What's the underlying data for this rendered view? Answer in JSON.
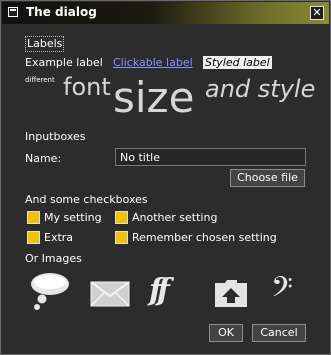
{
  "window": {
    "title": "The dialog",
    "close_glyph": "✕"
  },
  "labels_section": {
    "heading": "Labels",
    "example_label": "Example label",
    "clickable_label": "Clickable label",
    "styled_label": "Styled label",
    "font_demo": {
      "different": "different",
      "font": "font",
      "size": "size",
      "and_style": "and style"
    }
  },
  "inputboxes_section": {
    "heading": "Inputboxes",
    "name_label": "Name:",
    "name_value": "No title",
    "choose_file_label": "Choose file"
  },
  "checkboxes_section": {
    "heading": "And some checkboxes",
    "items": [
      {
        "label": "My setting"
      },
      {
        "label": "Another setting"
      },
      {
        "label": "Extra"
      },
      {
        "label": "Remember chosen setting"
      }
    ]
  },
  "images_section": {
    "heading": "Or Images",
    "icons": [
      "speech-bubble-icon",
      "envelope-icon",
      "ff-dynamics-icon",
      "upload-folder-icon",
      "bass-clef-icon"
    ],
    "ff_glyph": "ff",
    "bass_clef_glyph": "𝄢"
  },
  "footer": {
    "ok_label": "OK",
    "cancel_label": "Cancel"
  }
}
